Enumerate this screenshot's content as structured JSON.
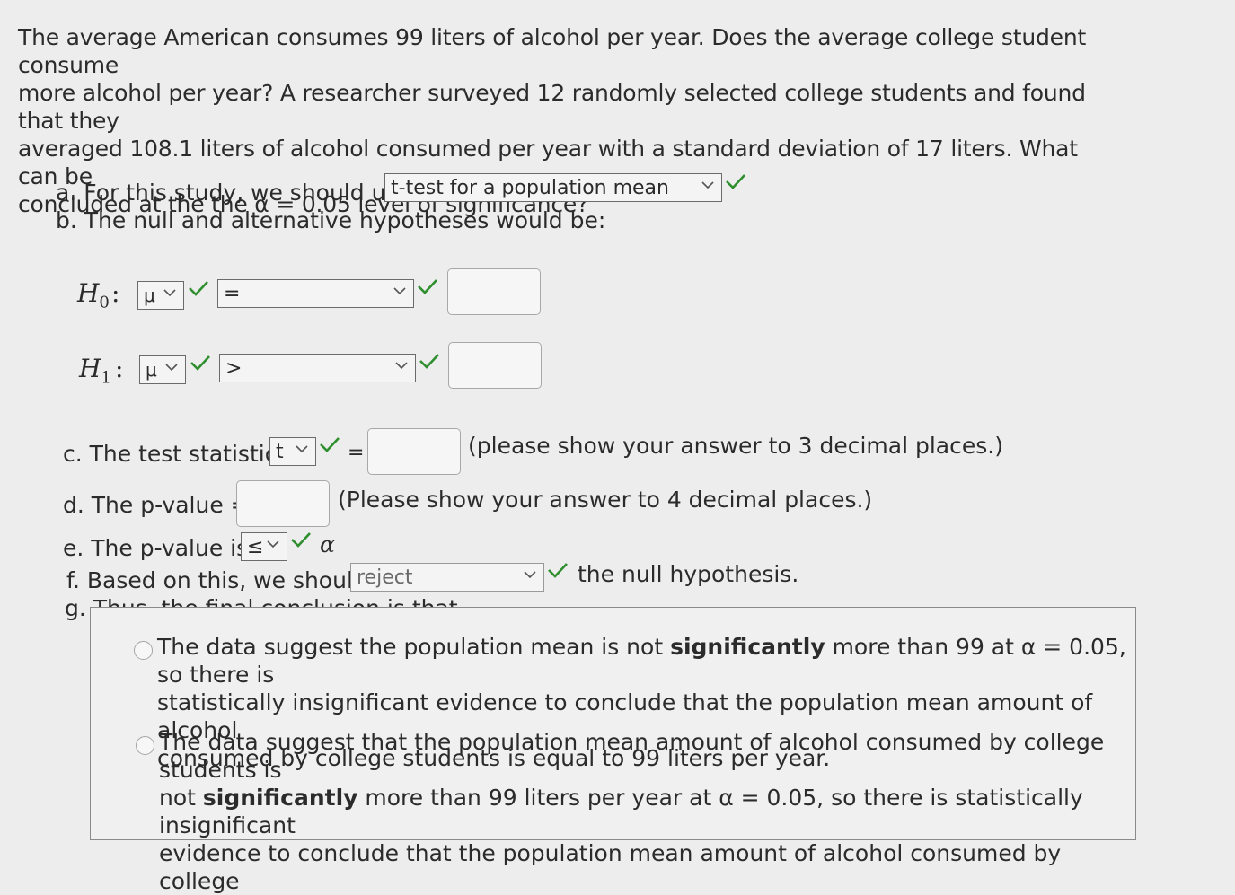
{
  "question": {
    "text": "The average American consumes 99 liters of alcohol per year. Does the average college student consume\nmore alcohol per year? A researcher surveyed 12 randomly selected college students and found that they\naveraged 108.1 liters of alcohol consumed per year with a standard deviation of 17 liters. What can be\nconcluded at the the α = 0.05 level of significance?"
  },
  "part_a": {
    "prefix": "a. For this study, we should use",
    "selected": "t-test for a population mean"
  },
  "part_b": {
    "text": "b. The null and alternative hypotheses would be:",
    "h0_label": "H",
    "h0_sub": "0",
    "h0_colon": ":",
    "h0_param": "μ",
    "h0_relation": "=",
    "h0_value": "",
    "h1_label": "H",
    "h1_sub": "1",
    "h1_colon": ":",
    "h1_param": "μ",
    "h1_relation": ">",
    "h1_value": ""
  },
  "part_c": {
    "prefix": "c. The test statistic",
    "selected": "t",
    "equals": "=",
    "value": "",
    "note": "(please show your answer to 3 decimal places.)"
  },
  "part_d": {
    "prefix": "d. The p-value =",
    "value": "",
    "note": "(Please show your answer to 4 decimal places.)"
  },
  "part_e": {
    "prefix": "e. The p-value is",
    "selected": "≤",
    "suffix": "α"
  },
  "part_f": {
    "prefix": "f. Based on this, we should",
    "selected": "reject",
    "suffix": "the null hypothesis."
  },
  "part_g": {
    "prefix": "g. Thus, the final conclusion is that ...",
    "options": [
      {
        "pre": "The data suggest the population mean is not ",
        "bold": "significantly",
        "post": " more than 99 at α = 0.05, so there is\nstatistically insignificant evidence to conclude that the population mean amount of alcohol\nconsumed by college students is equal to 99 liters per year."
      },
      {
        "pre": "The data suggest that the population mean amount of alcohol consumed by college students is\nnot ",
        "bold": "significantly",
        "post": " more than 99 liters per year at α = 0.05, so there is statistically insignificant\nevidence to conclude that the population mean amount of alcohol consumed by college"
      }
    ]
  },
  "colors": {
    "check": "#2f8f2f",
    "background": "#ededed",
    "text": "#2b2b2b"
  },
  "icons": {
    "check": "check-icon",
    "dropdown": "chevron-down-icon",
    "radio": "radio-button"
  }
}
